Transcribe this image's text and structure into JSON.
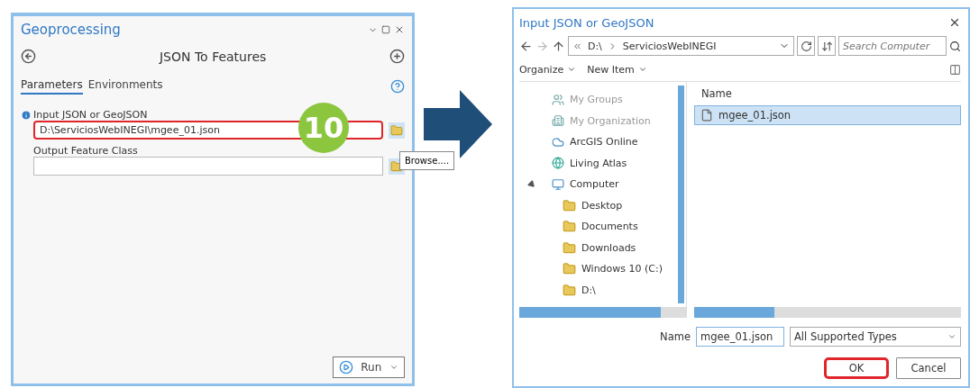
{
  "geoprocessing": {
    "title": "Geoprocessing",
    "tool_title": "JSON To Features",
    "tabs": [
      {
        "label": "Parameters",
        "selected": true
      },
      {
        "label": "Environments",
        "selected": false
      }
    ],
    "parameters": [
      {
        "label": "Input JSON or GeoJSON",
        "value": "D:\\ServiciosWebINEGI\\mgee_01.json",
        "highlighted": true,
        "info": true
      },
      {
        "label": "Output Feature Class",
        "highlighted": false,
        "info": false
      }
    ],
    "step_badge": "10",
    "tooltip": "Browse....",
    "run_button": "Run"
  },
  "file_dialog": {
    "title": "Input JSON or GeoJSON",
    "breadcrumb": [
      "D:\\",
      "ServiciosWebINEGI"
    ],
    "search": {
      "placeholder": "Search Computer"
    },
    "toolbar": [
      "Organize",
      "New Item"
    ],
    "nav": [
      {
        "label": "My Groups",
        "disabled": true,
        "kind": "group"
      },
      {
        "label": "My Organization",
        "disabled": true,
        "kind": "org"
      },
      {
        "label": "ArcGIS Online",
        "disabled": false,
        "kind": "cloud"
      },
      {
        "label": "Living Atlas",
        "disabled": false,
        "kind": "atlas"
      },
      {
        "label": "Computer",
        "disabled": false,
        "kind": "computer",
        "expanded": true,
        "children": [
          {
            "label": "Desktop",
            "disabled": false,
            "kind": "folder"
          },
          {
            "label": "Documents",
            "disabled": false,
            "kind": "folder"
          },
          {
            "label": "Downloads",
            "disabled": false,
            "kind": "folder"
          },
          {
            "label": "Windows 10 (C:)",
            "disabled": false,
            "kind": "folder"
          },
          {
            "label": "D:\\",
            "disabled": false,
            "kind": "folder"
          }
        ]
      }
    ],
    "column": "Name",
    "files": [
      {
        "name": "mgee_01.json",
        "selected": true
      }
    ],
    "name_label": "Name",
    "name_value": "mgee_01.json",
    "type_filter": "All Supported Types",
    "buttons": [
      {
        "label": "OK",
        "highlighted": true
      },
      {
        "label": "Cancel",
        "highlighted": false
      }
    ]
  }
}
